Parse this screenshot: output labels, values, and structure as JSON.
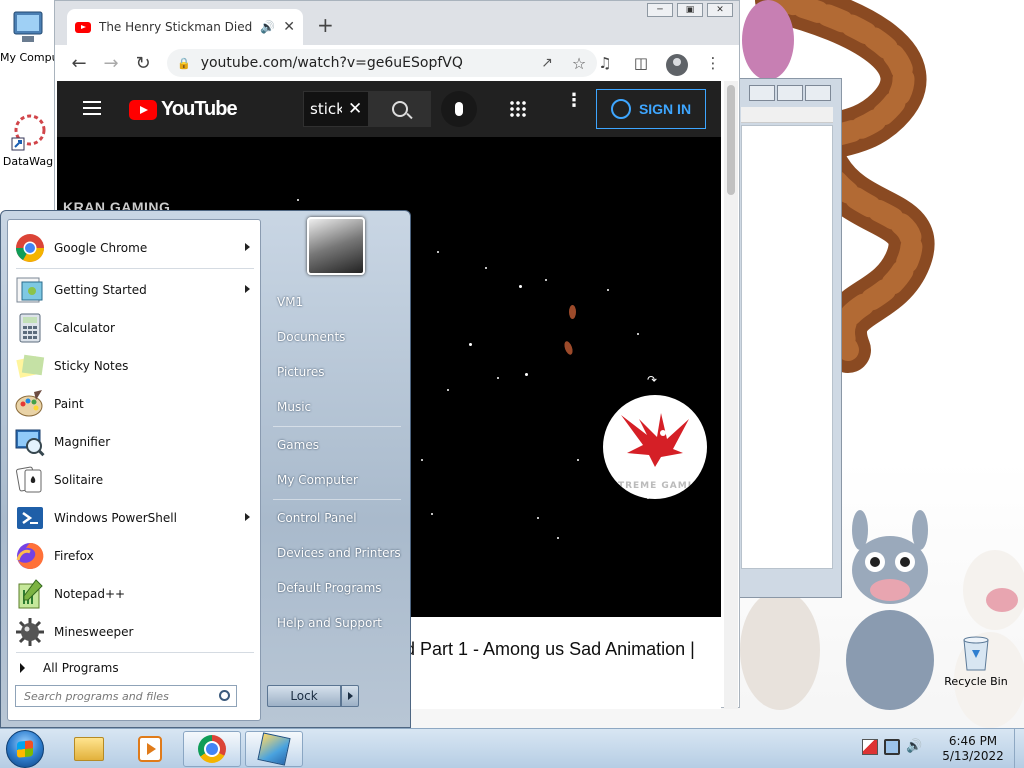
{
  "desktop": {
    "icons": [
      {
        "label": "My Computer"
      },
      {
        "label": "DataWag"
      },
      {
        "label": "Recycle Bin"
      }
    ]
  },
  "browser": {
    "tab_title": "The Henry Stickman Died fo",
    "url": "youtube.com/watch?v=ge6uESopfVQ",
    "youtube": {
      "logo_text": "YouTube",
      "search_text": "stick",
      "sign_in": "SIGN IN",
      "channel_watermark": "KRAN GAMING",
      "logo_caption": "TREME GAMI",
      "video_title": "d Part 1 - Among us Sad Animation |"
    }
  },
  "start_menu": {
    "programs": [
      {
        "label": "Google Chrome",
        "submenu": true
      },
      {
        "label": "Getting Started",
        "submenu": true
      },
      {
        "label": "Calculator",
        "submenu": false
      },
      {
        "label": "Sticky Notes",
        "submenu": false
      },
      {
        "label": "Paint",
        "submenu": false
      },
      {
        "label": "Magnifier",
        "submenu": false
      },
      {
        "label": "Solitaire",
        "submenu": false
      },
      {
        "label": "Windows PowerShell",
        "submenu": true
      },
      {
        "label": "Firefox",
        "submenu": false
      },
      {
        "label": "Notepad++",
        "submenu": false
      },
      {
        "label": "Minesweeper",
        "submenu": false
      }
    ],
    "all_programs": "All Programs",
    "search_placeholder": "Search programs and files",
    "right_items": [
      "VM1",
      "Documents",
      "Pictures",
      "Music",
      "Games",
      "My Computer",
      "Control Panel",
      "Devices and Printers",
      "Default Programs",
      "Help and Support"
    ],
    "lock_label": "Lock"
  },
  "taskbar": {
    "time": "6:46 PM",
    "date": "5/13/2022"
  },
  "colors": {
    "youtube_red": "#ff0000",
    "signin_blue": "#3ea6ff",
    "taskbar": "#b6cde4"
  }
}
